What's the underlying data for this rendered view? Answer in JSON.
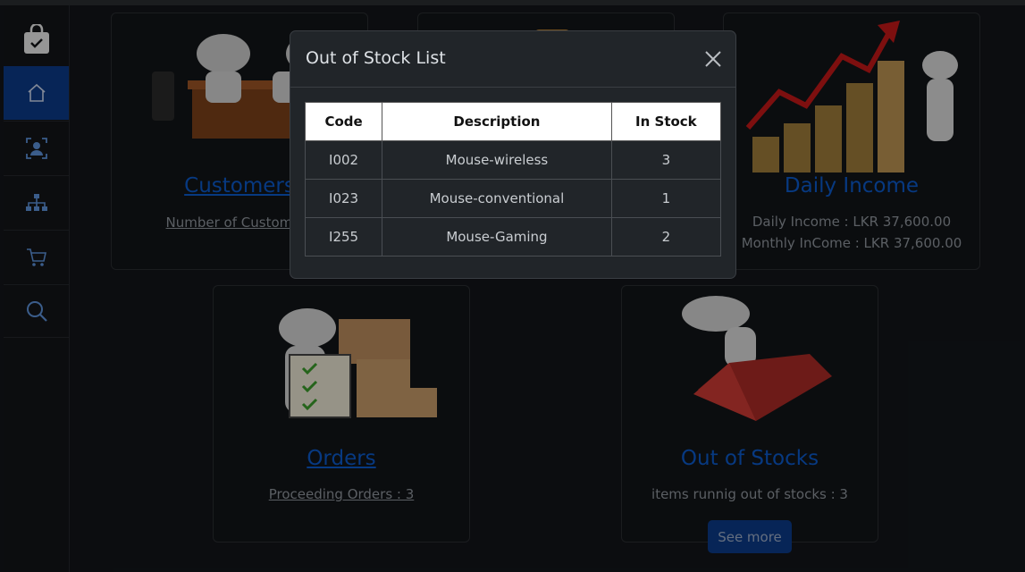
{
  "sidebar": {
    "items": [
      {
        "name": "home-icon"
      },
      {
        "name": "user-icon"
      },
      {
        "name": "hierarchy-icon"
      },
      {
        "name": "cart-icon"
      },
      {
        "name": "search-icon"
      }
    ],
    "logo": "shopping-bag-check-icon"
  },
  "cards": {
    "customers": {
      "title": "Customers",
      "sub": "Number of Customers"
    },
    "daily_income": {
      "title": "Daily Income",
      "line1": "Daily Income : LKR 37,600.00",
      "line2": "Monthly InCome : LKR 37,600.00"
    },
    "orders": {
      "title": "Orders",
      "sub": "Proceeding Orders : 3"
    },
    "out_of_stocks": {
      "title": "Out of Stocks",
      "sub": "items runnig out of stocks : 3",
      "button": "See more"
    }
  },
  "modal": {
    "title": "Out of Stock List",
    "columns": [
      "Code",
      "Description",
      "In Stock"
    ],
    "rows": [
      [
        "I002",
        "Mouse-wireless",
        "3"
      ],
      [
        "I023",
        "Mouse-conventional",
        "1"
      ],
      [
        "I255",
        "Mouse-Gaming",
        "2"
      ]
    ]
  },
  "colors": {
    "accent": "#0b58c7",
    "active": "#0b3a86",
    "background": "#13151a"
  }
}
